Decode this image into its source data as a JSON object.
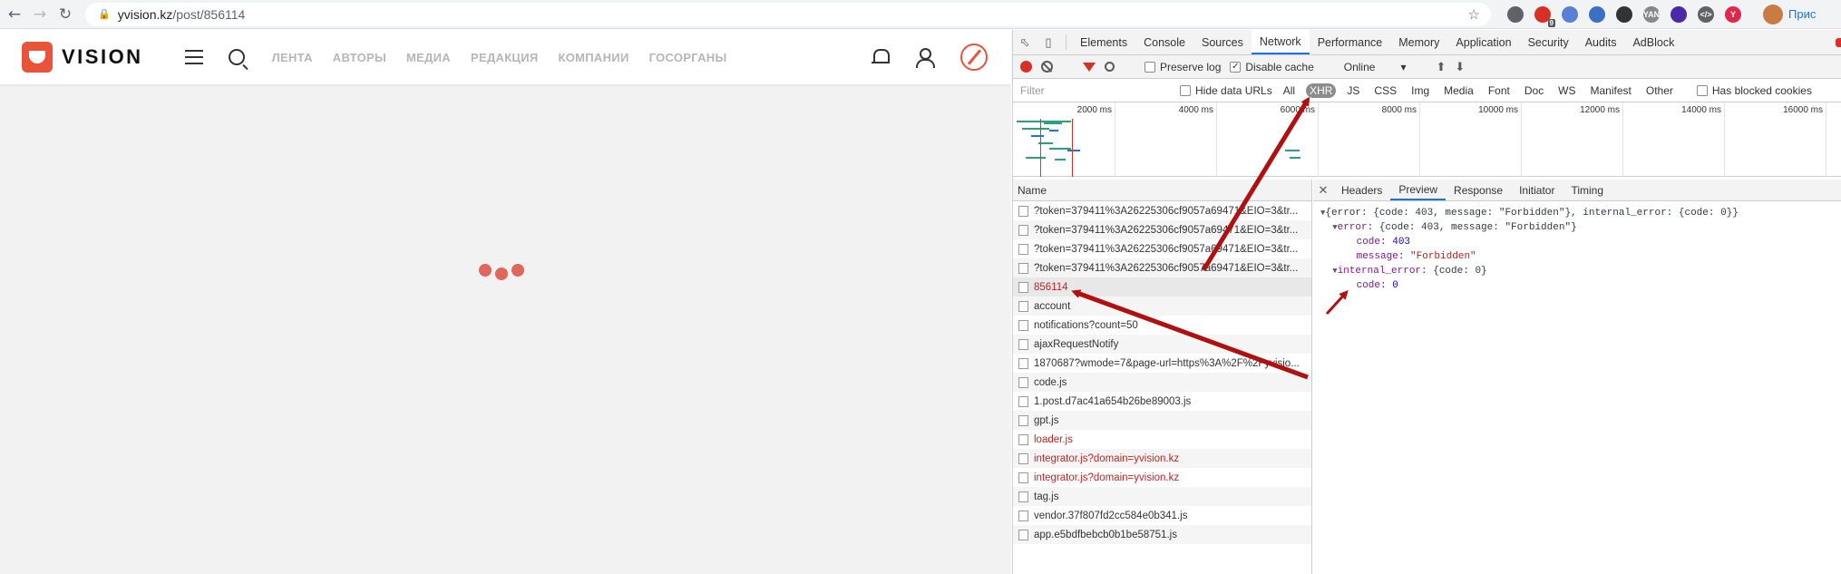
{
  "browser": {
    "url_host": "yvision.kz",
    "url_path": "/post/856114",
    "extensions": [
      {
        "name": "camera-icon",
        "color": "#5f6368",
        "label": ""
      },
      {
        "name": "extension-badge-icon",
        "color": "#d93025",
        "label": "",
        "badge": "9"
      },
      {
        "name": "extension-blue-icon",
        "color": "#5b7fd6",
        "label": ""
      },
      {
        "name": "extension-note-icon",
        "color": "#3b6fc4",
        "label": ""
      },
      {
        "name": "extension-bird-icon",
        "color": "#333333",
        "label": ""
      },
      {
        "name": "extension-yan-icon",
        "color": "#888888",
        "label": "YAN"
      },
      {
        "name": "extension-purple-icon",
        "color": "#4b2aa8",
        "label": ""
      },
      {
        "name": "extension-code-icon",
        "color": "#5f6368",
        "label": "</>"
      },
      {
        "name": "extension-y-icon",
        "color": "#e0294a",
        "label": "Y"
      }
    ],
    "profile_label": "Прис"
  },
  "site": {
    "logo_text": "VISION",
    "nav": [
      "ЛЕНТА",
      "АВТОРЫ",
      "МЕДИА",
      "РЕДАКЦИЯ",
      "КОМПАНИИ",
      "ГОСОРГАНЫ"
    ]
  },
  "devtools": {
    "tabs": [
      "Elements",
      "Console",
      "Sources",
      "Network",
      "Performance",
      "Memory",
      "Application",
      "Security",
      "Audits",
      "AdBlock"
    ],
    "active_tab": "Network",
    "toolbar": {
      "preserve_log": "Preserve log",
      "disable_cache": "Disable cache",
      "throttle": "Online"
    },
    "filter": {
      "placeholder": "Filter",
      "hide_data_urls": "Hide data URLs",
      "types": [
        "All",
        "XHR",
        "JS",
        "CSS",
        "Img",
        "Media",
        "Font",
        "Doc",
        "WS",
        "Manifest",
        "Other"
      ],
      "active_type": "XHR",
      "blocked_cookies": "Has blocked cookies"
    },
    "timeline_ticks": [
      "2000 ms",
      "4000 ms",
      "6000 ms",
      "8000 ms",
      "10000 ms",
      "12000 ms",
      "14000 ms",
      "16000 ms"
    ],
    "name_header": "Name",
    "requests": [
      {
        "name": "?token=379411%3A26225306cf9057a69471&EIO=3&tr...",
        "error": false
      },
      {
        "name": "?token=379411%3A26225306cf9057a69471&EIO=3&tr...",
        "error": false
      },
      {
        "name": "?token=379411%3A26225306cf9057a69471&EIO=3&tr...",
        "error": false
      },
      {
        "name": "?token=379411%3A26225306cf9057a69471&EIO=3&tr...",
        "error": false
      },
      {
        "name": "856114",
        "error": true
      },
      {
        "name": "account",
        "error": false
      },
      {
        "name": "notifications?count=50",
        "error": false
      },
      {
        "name": "ajaxRequestNotify",
        "error": false
      },
      {
        "name": "1870687?wmode=7&page-url=https%3A%2F%2Fyvisio...",
        "error": false
      },
      {
        "name": "code.js",
        "error": false
      },
      {
        "name": "1.post.d7ac41a654b26be89003.js",
        "error": false
      },
      {
        "name": "gpt.js",
        "error": false
      },
      {
        "name": "loader.js",
        "error": true
      },
      {
        "name": "integrator.js?domain=yvision.kz",
        "error": true
      },
      {
        "name": "integrator.js?domain=yvision.kz",
        "error": true
      },
      {
        "name": "tag.js",
        "error": false
      },
      {
        "name": "vendor.37f807fd2cc584e0b341.js",
        "error": false
      },
      {
        "name": "app.e5bdfbebcb0b1be58751.js",
        "error": false
      }
    ],
    "detail_tabs": [
      "Headers",
      "Preview",
      "Response",
      "Initiator",
      "Timing"
    ],
    "active_detail_tab": "Preview",
    "preview": {
      "root": "{error: {code: 403, message: \"Forbidden\"}, internal_error: {code: 0}}",
      "error_key": "error",
      "error_summary": "{code: 403, message: \"Forbidden\"}",
      "code_key": "code",
      "code_value": "403",
      "message_key": "message",
      "message_value": "\"Forbidden\"",
      "internal_key": "internal_error",
      "internal_summary": "{code: 0}",
      "internal_code_key": "code",
      "internal_code_value": "0"
    }
  },
  "colors": {
    "brand": "#e8533a",
    "loader": "#e0675a",
    "annotation": "#b01010",
    "devtools_accent": "#1a73e8",
    "error_text": "#c5221f"
  }
}
